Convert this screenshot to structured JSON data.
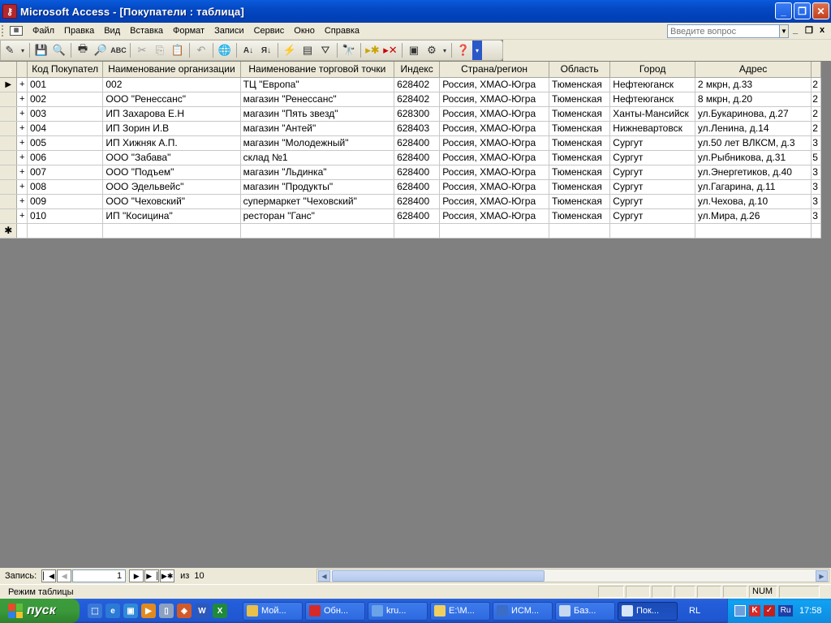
{
  "window": {
    "title": "Microsoft Access - [Покупатели : таблица]",
    "min": "_",
    "restore": "❐",
    "close": "✕"
  },
  "menu": {
    "items": [
      "Файл",
      "Правка",
      "Вид",
      "Вставка",
      "Формат",
      "Записи",
      "Сервис",
      "Окно",
      "Справка"
    ],
    "help_placeholder": "Введите вопрос",
    "mdi_min": "_",
    "mdi_restore": "❐",
    "mdi_close": "x"
  },
  "table": {
    "columns": [
      "Код Покупател",
      "Наименование организации",
      "Наименование торговой точки",
      "Индекс",
      "Страна/регион",
      "Область",
      "Город",
      "Адрес",
      ""
    ],
    "rows": [
      [
        "001",
        "002",
        "ТЦ \"Европа\"",
        "628402",
        "Россия, ХМАО-Югра",
        "Тюменская",
        "Нефтеюганск",
        "2 мкрн, д.33",
        "2"
      ],
      [
        "002",
        "ООО \"Ренессанс\"",
        "магазин \"Ренессанс\"",
        "628402",
        "Россия, ХМАО-Югра",
        "Тюменская",
        "Нефтеюганск",
        "8 мкрн, д.20",
        "2"
      ],
      [
        "003",
        "ИП Захарова Е.Н",
        "магазин \"Пять звезд\"",
        "628300",
        "Россия, ХМАО-Югра",
        "Тюменская",
        "Ханты-Мансийск",
        "ул.Букаринова, д.27",
        "2"
      ],
      [
        "004",
        "ИП Зорин И.В",
        "магазин \"Антей\"",
        "628403",
        "Россия, ХМАО-Югра",
        "Тюменская",
        "Нижневартовск",
        "ул.Ленина, д.14",
        "2"
      ],
      [
        "005",
        "ИП Хижняк А.П.",
        "магазин \"Молодежный\"",
        "628400",
        "Россия, ХМАО-Югра",
        "Тюменская",
        "Сургут",
        "ул.50 лет ВЛКСМ, д.3",
        "3"
      ],
      [
        "006",
        "ООО \"Забава\"",
        "склад №1",
        "628400",
        "Россия, ХМАО-Югра",
        "Тюменская",
        "Сургут",
        "ул.Рыбникова, д.31",
        "5"
      ],
      [
        "007",
        "ООО \"Подъем\"",
        "магазин \"Льдинка\"",
        "628400",
        "Россия, ХМАО-Югра",
        "Тюменская",
        "Сургут",
        "ул.Энергетиков, д.40",
        "3"
      ],
      [
        "008",
        "ООО Эдельвейс\"",
        "магазин \"Продукты\"",
        "628400",
        "Россия, ХМАО-Югра",
        "Тюменская",
        "Сургут",
        "ул.Гагарина, д.11",
        "3"
      ],
      [
        "009",
        "ООО \"Чеховский\"",
        "супермаркет \"Чеховский\"",
        "628400",
        "Россия, ХМАО-Югра",
        "Тюменская",
        "Сургут",
        "ул.Чехова, д.10",
        "3"
      ],
      [
        "010",
        "ИП \"Косицина\"",
        "ресторан \"Ганс\"",
        "628400",
        "Россия, ХМАО-Югра",
        "Тюменская",
        "Сургут",
        "ул.Мира, д.26",
        "3"
      ]
    ],
    "current_row_marker": "▶",
    "new_row_marker": "✱",
    "expand_marker": "+"
  },
  "nav": {
    "label": "Запись:",
    "current": "1",
    "of_label": "из",
    "total": "10"
  },
  "status": {
    "mode": "Режим таблицы",
    "num": "NUM"
  },
  "taskbar": {
    "start": "пуск",
    "tasks": [
      {
        "label": "Мой...",
        "color": "#e8c04a",
        "active": false
      },
      {
        "label": "Обн...",
        "color": "#d42a2a",
        "active": false
      },
      {
        "label": "kru...",
        "color": "#6aa3e8",
        "active": false
      },
      {
        "label": "E:\\М...",
        "color": "#f0cf60",
        "active": false
      },
      {
        "label": "ИСМ...",
        "color": "#3a6cc8",
        "active": false
      },
      {
        "label": "Баз...",
        "color": "#c8d8f0",
        "active": false
      },
      {
        "label": "Пок...",
        "color": "#d8e4f8",
        "active": true
      }
    ],
    "lang": "RL",
    "tray_lang": "Ru",
    "time": "17:58"
  }
}
